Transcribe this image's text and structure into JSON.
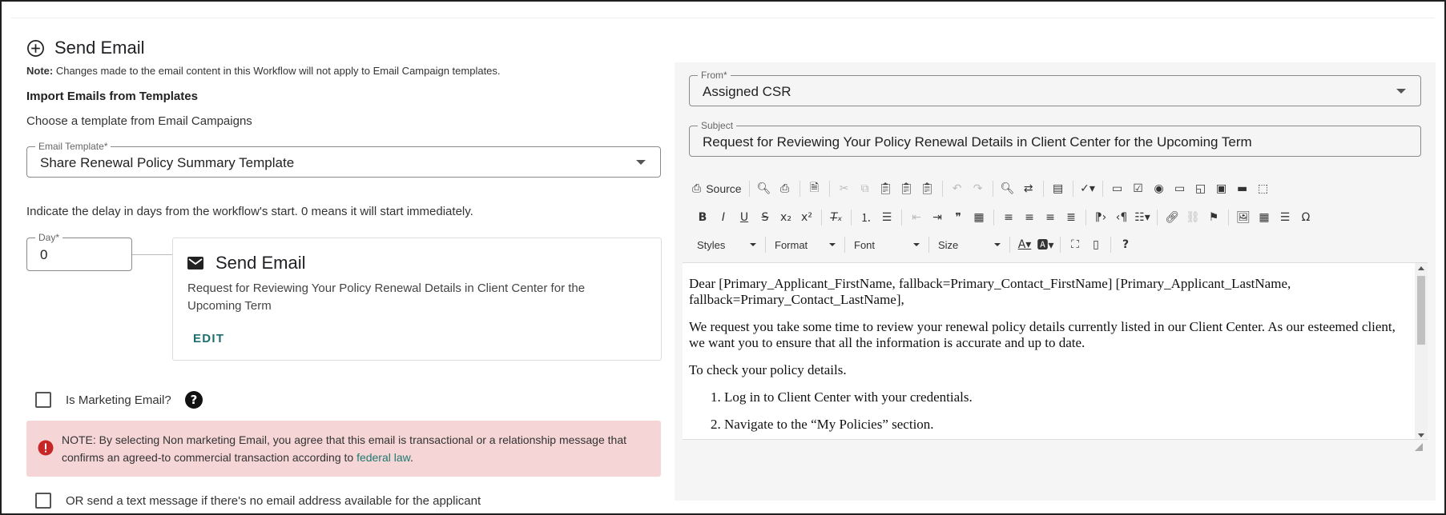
{
  "header": {
    "title": "Send Email",
    "note_label": "Note:",
    "note_text": " Changes made to the email content in this Workflow will not apply to Email Campaign templates."
  },
  "import": {
    "title": "Import Emails from Templates",
    "subtitle": "Choose a template from Email Campaigns",
    "template_label": "Email Template*",
    "template_value": "Share Renewal Policy Summary Template"
  },
  "delay": {
    "text": "Indicate the delay in days from the workflow's start. 0 means it will start immediately.",
    "day_label": "Day*",
    "day_value": "0"
  },
  "card": {
    "title": "Send Email",
    "subject": "Request for Reviewing Your Policy Renewal Details in Client Center for the Upcoming Term",
    "edit_label": "EDIT"
  },
  "marketing": {
    "label": "Is Marketing Email?"
  },
  "alert": {
    "text": "NOTE: By selecting Non marketing Email, you agree that this email is transactional or a relationship message that confirms an agreed-to commercial transaction according to ",
    "link": "federal law",
    "suffix": "."
  },
  "sms": {
    "label": "OR send a text message if there's no email address available for the applicant"
  },
  "email_form": {
    "from_label": "From*",
    "from_value": "Assigned CSR",
    "subject_label": "Subject",
    "subject_value": "Request for Reviewing Your Policy Renewal Details in Client Center for the Upcoming Term"
  },
  "toolbar": {
    "source_label": "Source",
    "styles": "Styles",
    "format": "Format",
    "font": "Font",
    "size": "Size"
  },
  "body": {
    "greeting": "Dear [Primary_Applicant_FirstName, fallback=Primary_Contact_FirstName] [Primary_Applicant_LastName, fallback=Primary_Contact_LastName],",
    "para1": "We request you take some time to review your renewal policy details currently listed in our Client Center. As our esteemed client, we want you to ensure that all the information is accurate and up to date.",
    "para2": "To check your policy details.",
    "steps": [
      "Log in to Client Center with your credentials.",
      "Navigate to the “My Policies” section."
    ]
  },
  "colors": {
    "accent": "#1d6e6e",
    "alert_bg": "#f5d5d5",
    "panel_bg": "#f5f5f5"
  }
}
